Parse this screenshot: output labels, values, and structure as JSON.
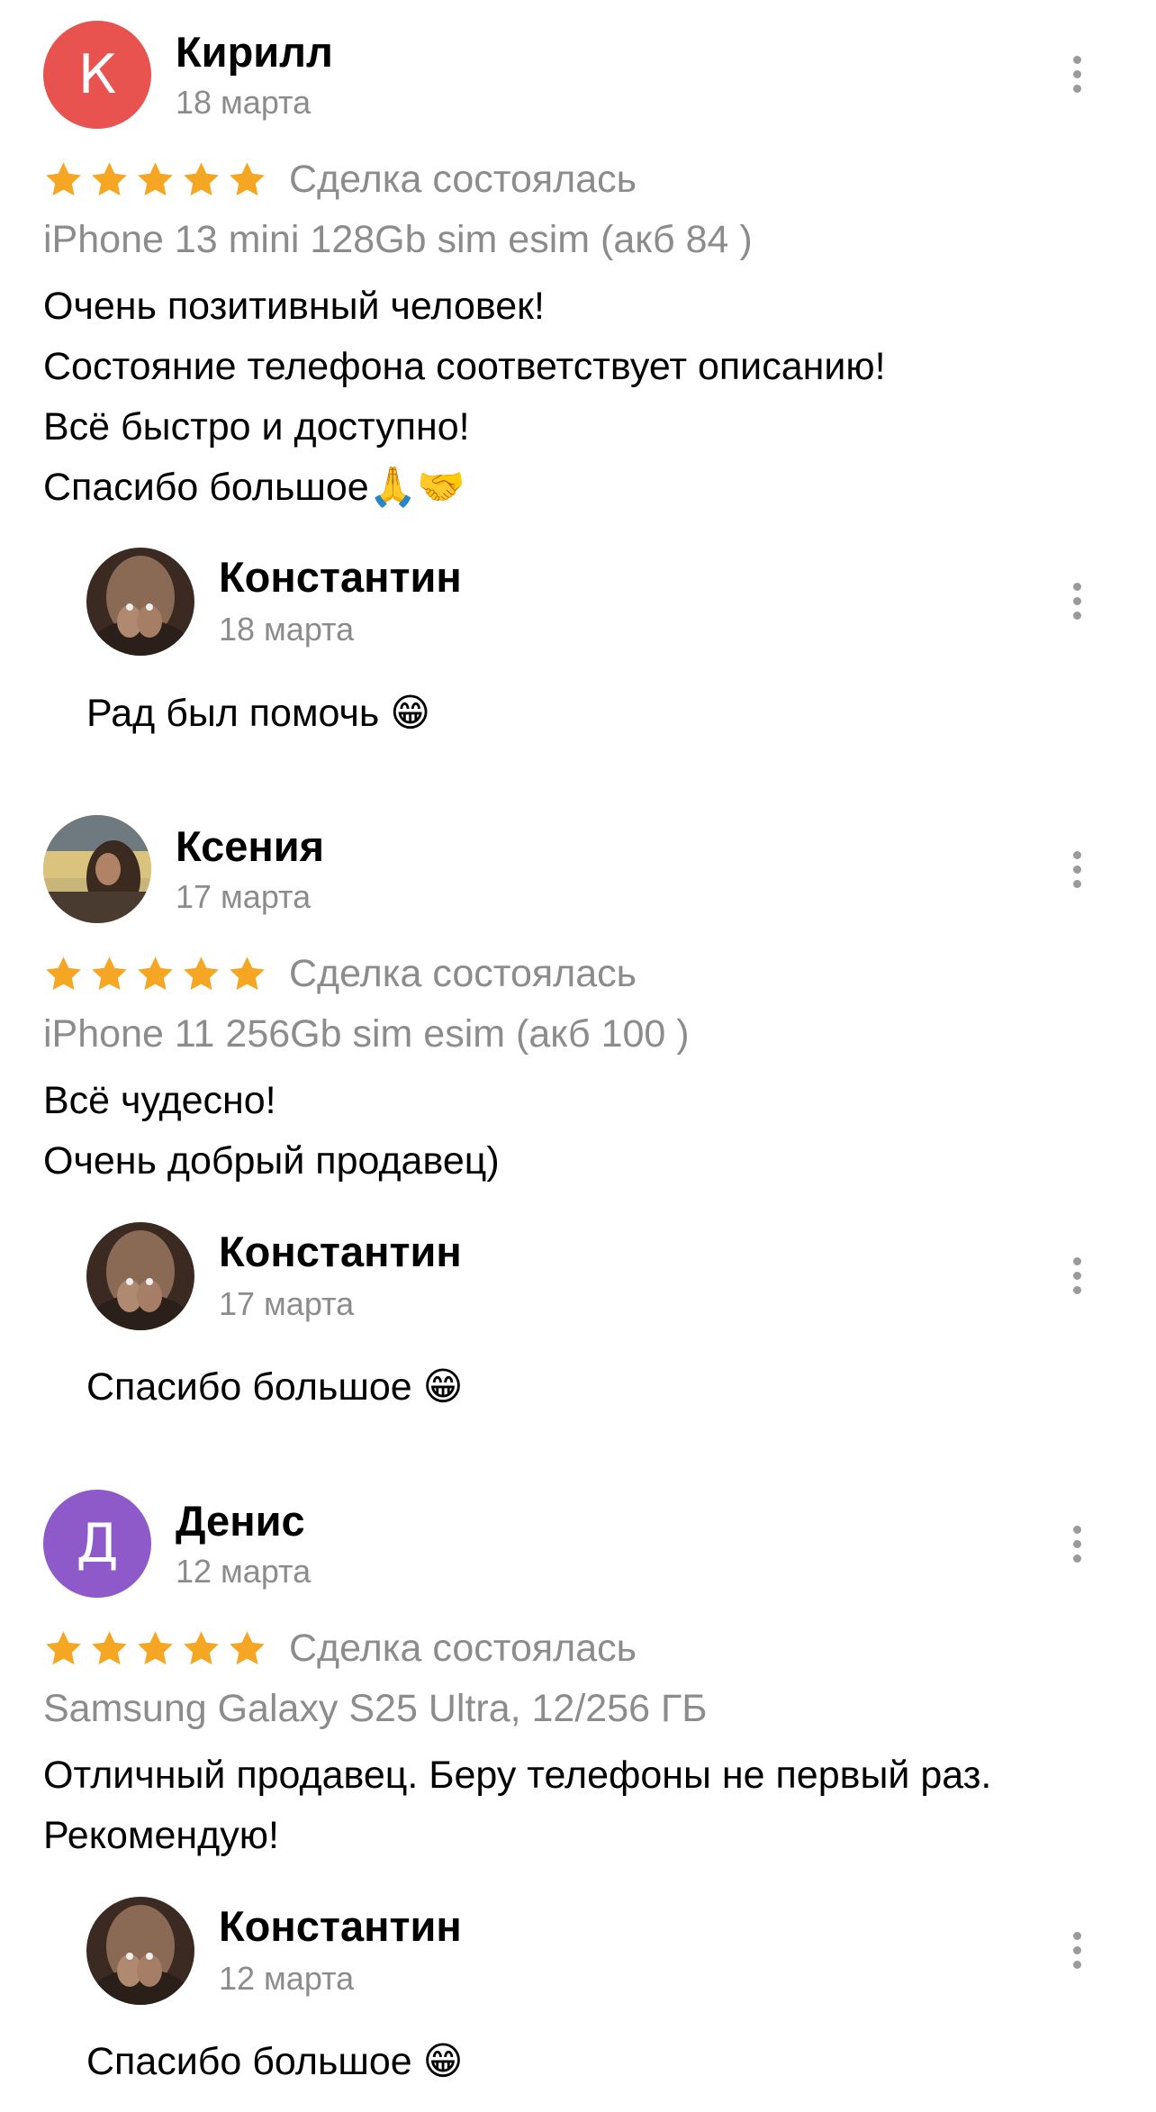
{
  "reviews": [
    {
      "author": "Кирилл",
      "avatar_letter": "К",
      "avatar_color": "#e8524f",
      "date": "18 марта",
      "rating": 5,
      "deal_status": "Сделка состоялась",
      "product": "iPhone 13 mini 128Gb sim esim (акб 84 )",
      "lines": [
        "Очень позитивный человек!",
        "Состояние телефона соответствует описанию!",
        "Всё быстро и доступно!",
        "Спасибо большое🙏🤝"
      ],
      "reply": {
        "author": "Константин",
        "date": "18 марта",
        "text": "Рад был помочь 😁"
      }
    },
    {
      "author": "Ксения",
      "date": "17 марта",
      "rating": 5,
      "deal_status": "Сделка состоялась",
      "product": "iPhone 11 256Gb sim esim (акб 100 )",
      "lines": [
        "Всё чудесно!",
        "Очень добрый продавец)"
      ],
      "reply": {
        "author": "Константин",
        "date": "17 марта",
        "text": "Спасибо большое 😁"
      }
    },
    {
      "author": "Денис",
      "avatar_letter": "Д",
      "avatar_color": "#8e59c9",
      "date": "12 марта",
      "rating": 5,
      "deal_status": "Сделка состоялась",
      "product": "Samsung Galaxy S25 Ultra, 12/256 ГБ",
      "lines": [
        "Отличный продавец. Беру телефоны не первый раз.",
        "Рекомендую!"
      ],
      "reply": {
        "author": "Константин",
        "date": "12 марта",
        "text": "Спасибо большое 😁"
      }
    }
  ],
  "colors": {
    "star": "#f5a623",
    "secondary_text": "#8c8c8c",
    "menu_dots": "#9a9a9a"
  },
  "icons": {
    "star": "star-icon",
    "menu": "more-vertical-icon"
  }
}
